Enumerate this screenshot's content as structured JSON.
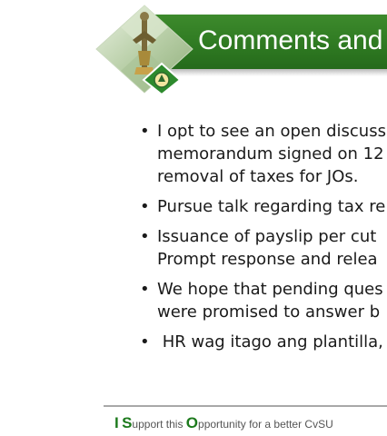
{
  "slide": {
    "title": "Comments and",
    "bullets": [
      {
        "text": "I opt to see an open discuss\nmemorandum signed on 12\nremoval of taxes for JOs."
      },
      {
        "text": "Pursue talk regarding tax re"
      },
      {
        "text": "Issuance of payslip per cut\nPrompt response and relea"
      },
      {
        "text": "We hope that pending ques\nwere promised to answer b"
      },
      {
        "text": " HR wag itago ang plantilla,"
      }
    ]
  },
  "footer": {
    "i_letter": "I",
    "s_letter": "S",
    "s_rest": "upport this ",
    "o_letter": "O",
    "o_rest": "pportunity for a better CvSU"
  },
  "colors": {
    "banner_green": "#2f7a22",
    "footer_green": "#1d7a1d",
    "text": "#1a1a1a"
  },
  "icons": {
    "emblem": "university-seal-diamond-icon"
  }
}
